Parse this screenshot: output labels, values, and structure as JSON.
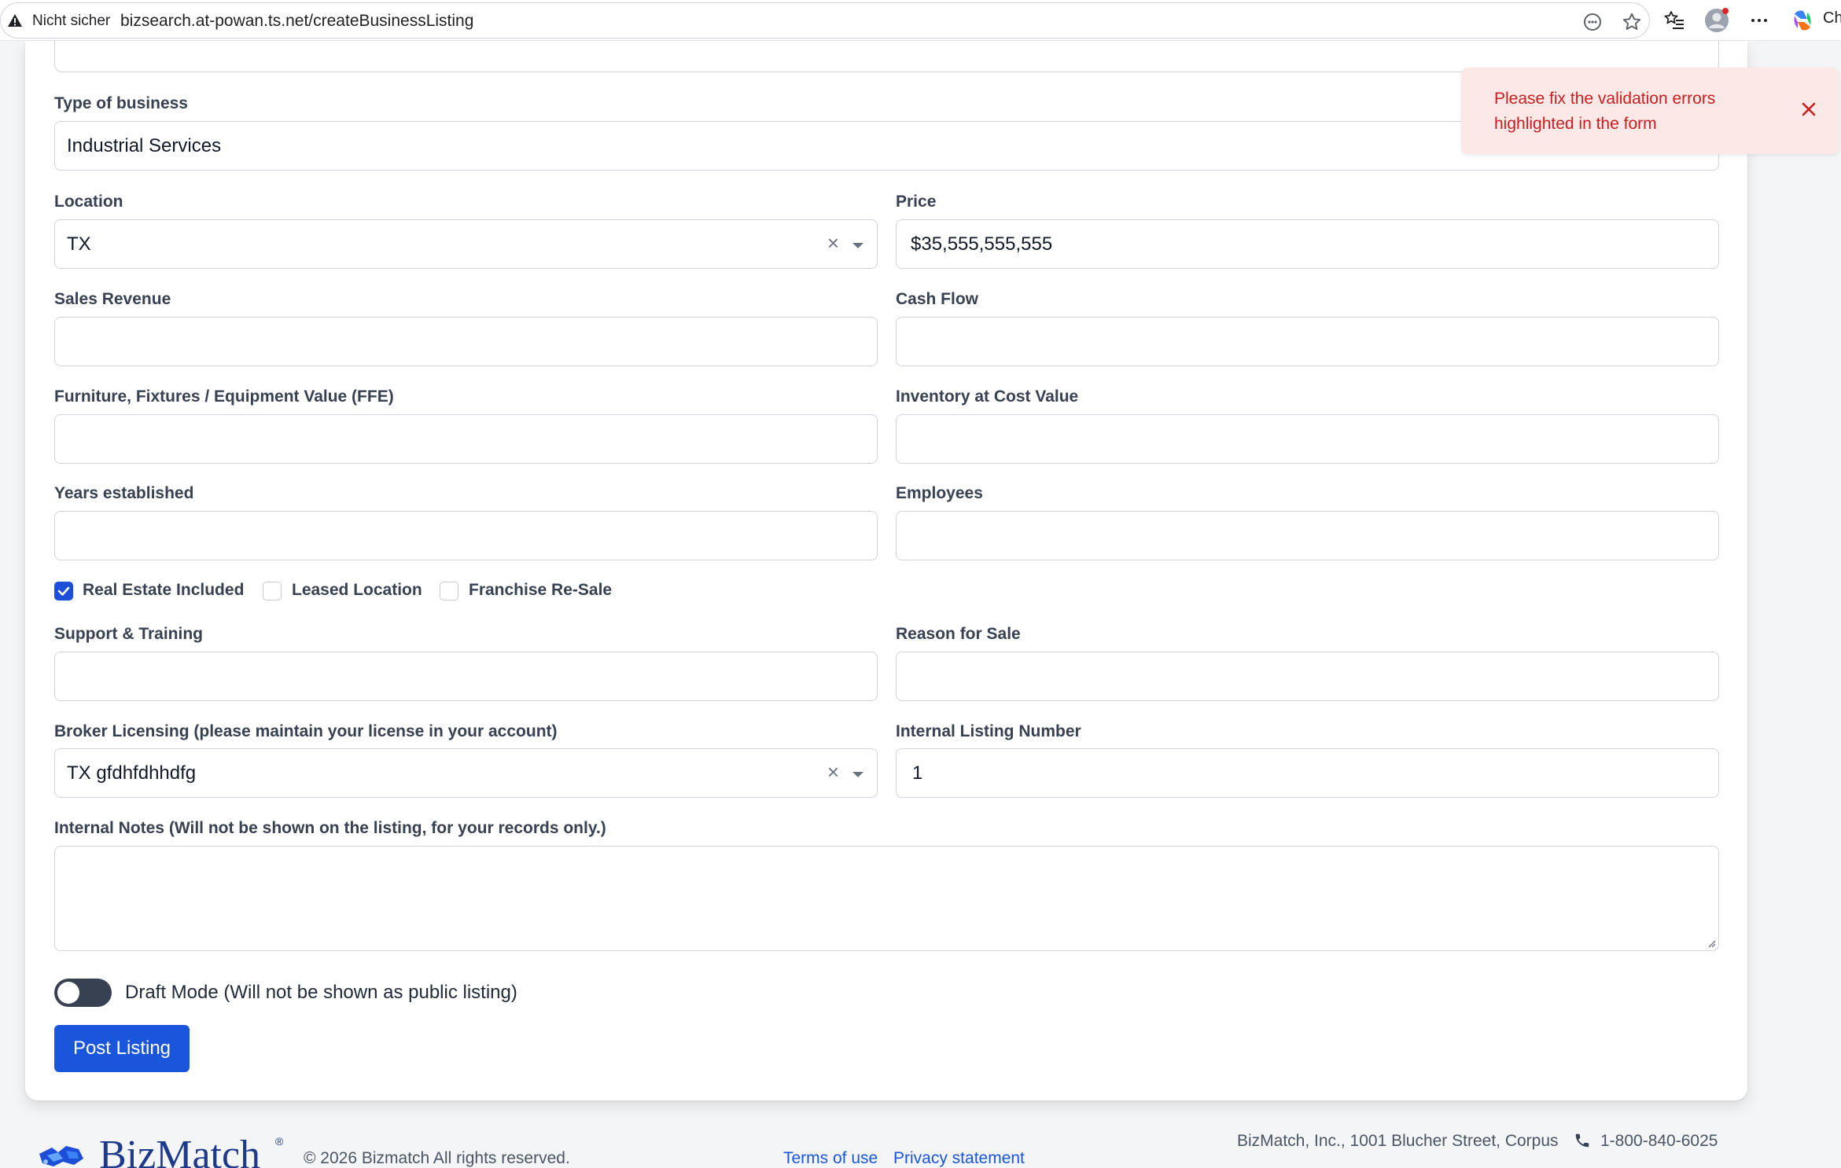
{
  "browser": {
    "security_label": "Nicht sicher",
    "url": "bizsearch.at-powan.ts.net/createBusinessListing",
    "copilot_label": "Ch"
  },
  "form": {
    "type_of_business": {
      "label": "Type of business",
      "value": "Industrial Services"
    },
    "location": {
      "label": "Location",
      "value": "TX"
    },
    "price": {
      "label": "Price",
      "value": "$35,555,555,555"
    },
    "sales_revenue": {
      "label": "Sales Revenue",
      "value": ""
    },
    "cash_flow": {
      "label": "Cash Flow",
      "value": ""
    },
    "ffe": {
      "label": "Furniture, Fixtures / Equipment Value (FFE)",
      "value": ""
    },
    "inventory": {
      "label": "Inventory at Cost Value",
      "value": ""
    },
    "years_established": {
      "label": "Years established",
      "value": ""
    },
    "employees": {
      "label": "Employees",
      "value": ""
    },
    "checkboxes": [
      {
        "label": "Real Estate Included",
        "checked": true
      },
      {
        "label": "Leased Location",
        "checked": false
      },
      {
        "label": "Franchise Re-Sale",
        "checked": false
      }
    ],
    "support_training": {
      "label": "Support & Training",
      "value": ""
    },
    "reason_for_sale": {
      "label": "Reason for Sale",
      "value": ""
    },
    "broker_licensing": {
      "label": "Broker Licensing (please maintain your license in your account)",
      "value": "TX gfdhfdhhdfg"
    },
    "internal_listing_number": {
      "label": "Internal Listing Number",
      "value": "1"
    },
    "internal_notes": {
      "label": "Internal Notes (Will not be shown on the listing, for your records only.)",
      "value": ""
    },
    "draft_mode": {
      "label": "Draft Mode (Will not be shown as public listing)",
      "on": false
    },
    "submit_label": "Post Listing"
  },
  "toast": {
    "message": "Please fix the validation errors highlighted in the form"
  },
  "footer": {
    "logo_text": "BizMatch",
    "copyright": "© 2026 Bizmatch All rights reserved.",
    "terms": "Terms of use",
    "privacy": "Privacy statement",
    "address": "BizMatch, Inc., 1001 Blucher Street, Corpus",
    "phone": "1-800-840-6025"
  },
  "colors": {
    "primary": "#1a56db",
    "error_text": "#c81e1e",
    "error_bg": "#fde8e8",
    "toggle_off": "#374151"
  }
}
